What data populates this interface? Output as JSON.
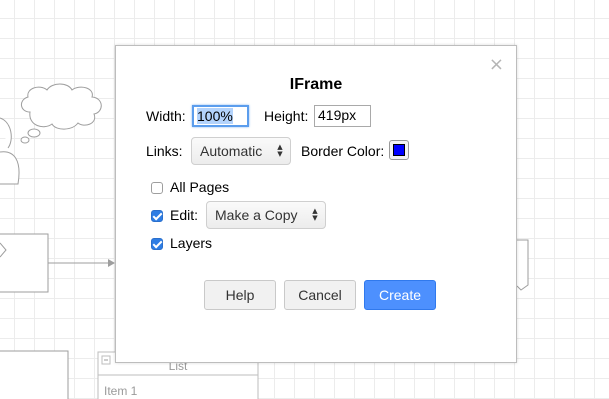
{
  "background": {
    "list_title": "List",
    "list_item": "Item 1"
  },
  "dialog": {
    "title": "IFrame",
    "close_icon": "close-icon",
    "width_label": "Width:",
    "width_value": "100%",
    "height_label": "Height:",
    "height_value": "419px",
    "links_label": "Links:",
    "links_selected": "Automatic",
    "border_color_label": "Border Color:",
    "border_color": "#0000ff",
    "all_pages_label": "All Pages",
    "all_pages_checked": false,
    "edit_label": "Edit:",
    "edit_checked": true,
    "edit_selected": "Make a Copy",
    "layers_label": "Layers",
    "layers_checked": true,
    "help_label": "Help",
    "cancel_label": "Cancel",
    "create_label": "Create"
  },
  "colors": {
    "primary_button": "#4d90fe",
    "focus": "#5b9ded"
  }
}
